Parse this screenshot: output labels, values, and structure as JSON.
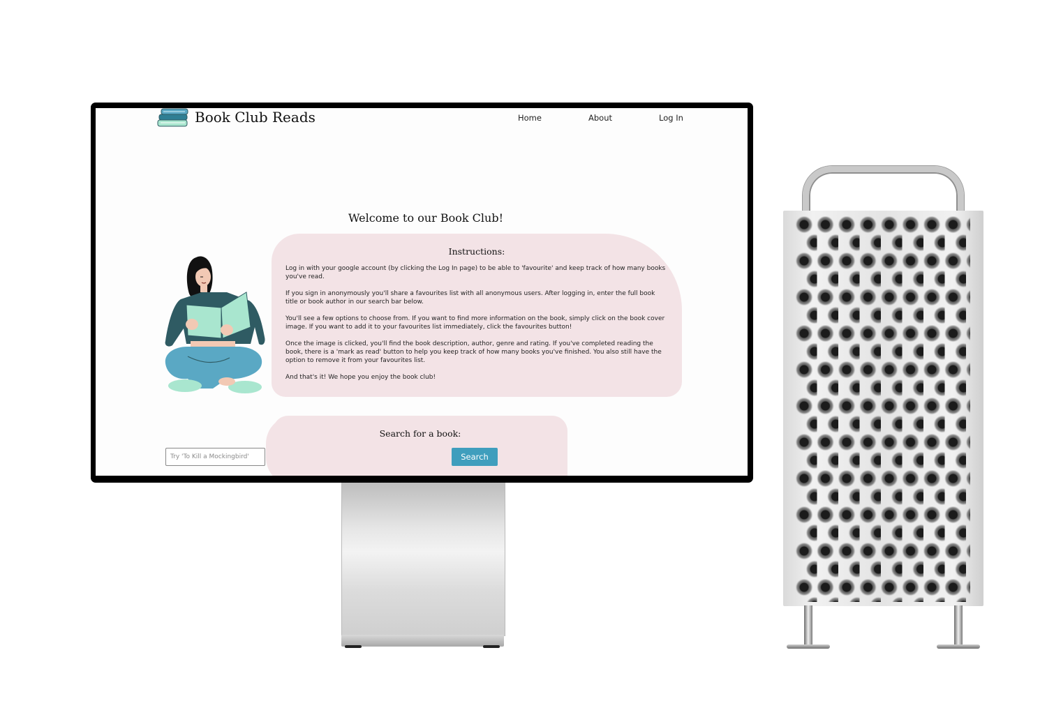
{
  "app": {
    "brand": "Book Club Reads",
    "nav": [
      "Home",
      "About",
      "Log In"
    ]
  },
  "main": {
    "welcome": "Welcome to our Book Club!",
    "instructions": {
      "title": "Instructions:",
      "paragraphs": [
        "Log in with your google account (by clicking the Log In page) to be able to 'favourite' and keep track of how many books you've read.",
        "If you sign in anonymously you'll share a favourites list with all anonymous users. After logging in, enter the full book title or book author in our search bar below.",
        "You'll see a few options to choose from. If you want to find more information on the book, simply click on the book cover image. If you want to add it to your favourites list immediately, click the favourites button!",
        "Once the image is clicked, you'll find the book description, author, genre and rating. If you've completed reading the book, there is a 'mark as read' button to help you keep track of how many books you've finished. You also still have the option to remove it from your favourites list.",
        "And that's it! We hope you enjoy the book club!"
      ]
    },
    "search": {
      "title": "Search for a book:",
      "placeholder": "Try 'To Kill a Mockingbird'",
      "button": "Search"
    }
  },
  "colors": {
    "panel": "#f3e3e6",
    "button": "#3f9ebd",
    "teal": "#5aa8c4",
    "mint": "#a9e6cf",
    "dark_teal": "#2f5b63"
  },
  "icons": [
    "book-stack-logo-icon",
    "reader-illustration"
  ]
}
